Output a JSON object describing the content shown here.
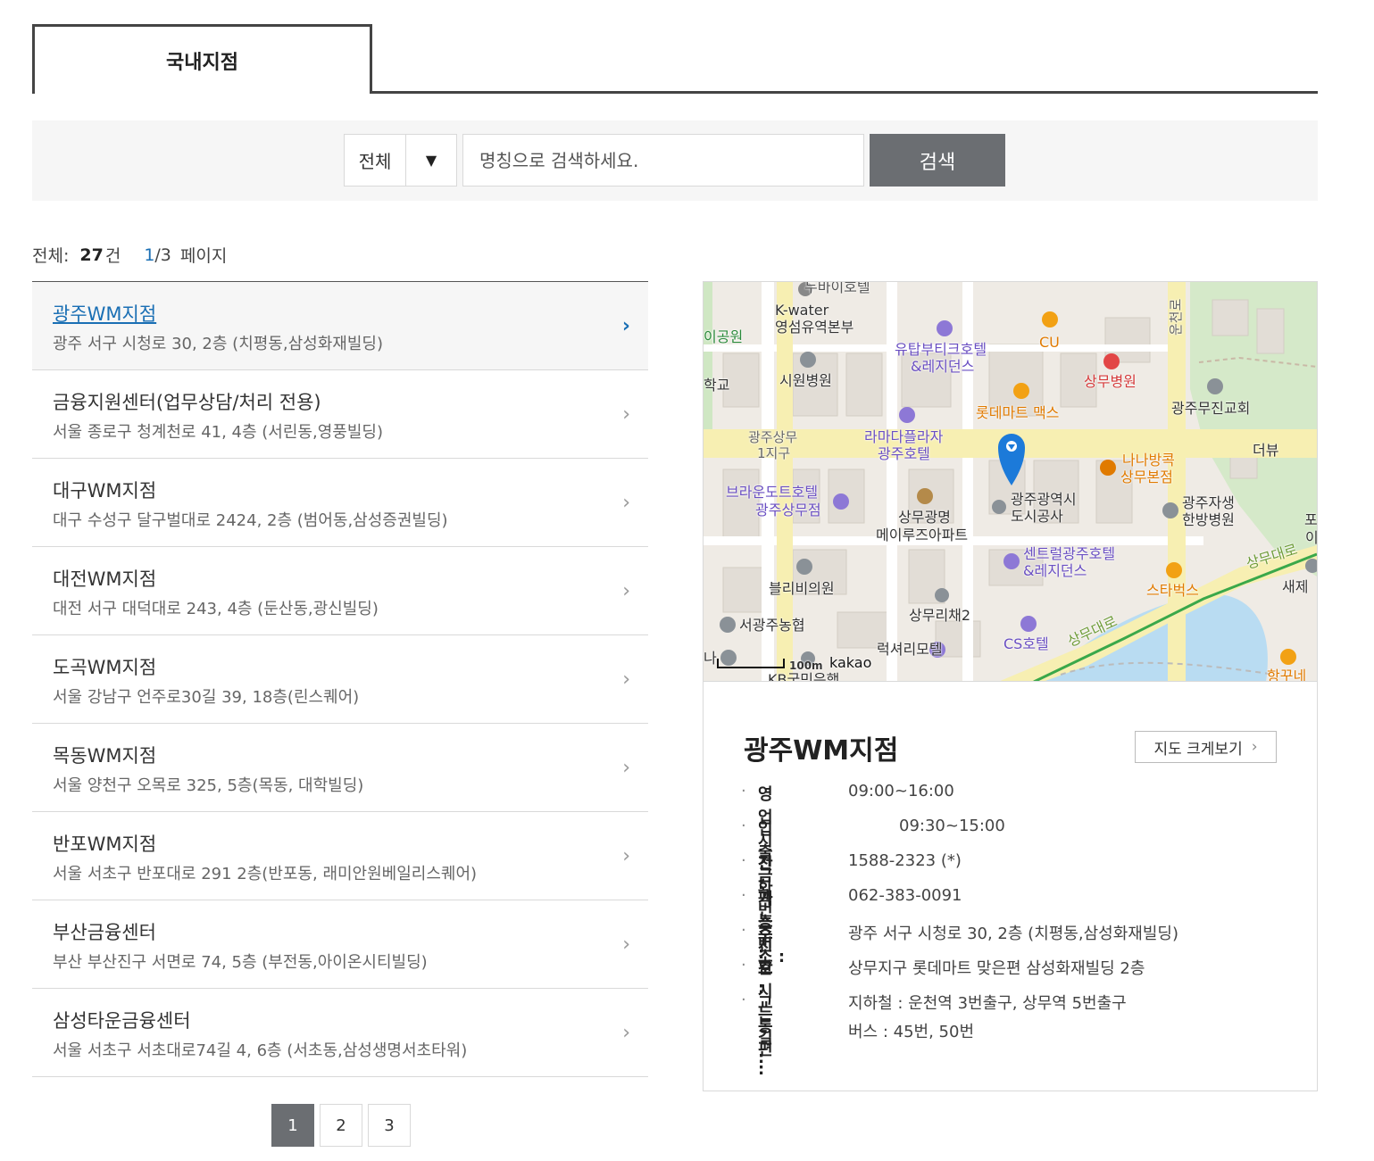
{
  "tabs": [
    {
      "label": "국내지점",
      "active": true
    }
  ],
  "search": {
    "category_selected": "전체",
    "placeholder": "명칭으로 검색하세요.",
    "button_label": "검색"
  },
  "summary": {
    "total_label": "전체:",
    "total_count": "27",
    "total_unit": "건",
    "current_page": "1",
    "total_pages": "/3",
    "page_label": "페이지"
  },
  "branches": [
    {
      "name": "광주WM지점",
      "address": "광주 서구 시청로 30, 2층 (치평동,삼성화재빌딩)",
      "active": true
    },
    {
      "name": "금융지원센터(업무상담/처리 전용)",
      "address": "서울 종로구 청계천로 41, 4층 (서린동,영풍빌딩)"
    },
    {
      "name": "대구WM지점",
      "address": "대구 수성구 달구벌대로 2424, 2층 (범어동,삼성증권빌딩)"
    },
    {
      "name": "대전WM지점",
      "address": "대전 서구 대덕대로 243, 4층 (둔산동,광신빌딩)"
    },
    {
      "name": "도곡WM지점",
      "address": "서울 강남구 언주로30길 39, 18층(린스퀘어)"
    },
    {
      "name": "목동WM지점",
      "address": "서울 양천구 오목로 325, 5층(목동, 대학빌딩)"
    },
    {
      "name": "반포WM지점",
      "address": "서울 서초구 반포대로 291 2층(반포동, 래미안원베일리스퀘어)"
    },
    {
      "name": "부산금융센터",
      "address": "부산 부산진구 서면로 74, 5층 (부전동,아이온시티빌딩)"
    },
    {
      "name": "삼성타운금융센터",
      "address": "서울 서초구 서초대로74길 4, 6층 (서초동,삼성생명서초타워)"
    }
  ],
  "chevron_glyph": "›",
  "pagination": {
    "pages": [
      "1",
      "2",
      "3"
    ],
    "current": "1"
  },
  "map": {
    "scale_label": "100m",
    "brand": "kakao",
    "labels": {
      "kwater_1": "K-water",
      "kwater_2": "영섬유역본부",
      "park": "이공원",
      "school": "학교",
      "utop_1": "유탑부티크호텔",
      "utop_2": "&레지던스",
      "cu": "CU",
      "siwon": "시원병원",
      "sangmu_hosp": "상무병원",
      "lotte": "롯데마트 맥스",
      "church": "광주무진교회",
      "theview": "더뷰",
      "ramada_1": "라마다플라자",
      "ramada_2": "광주호텔",
      "gwangju_sangmu_1": "광주상무",
      "gwangju_sangmu_2": "1지구",
      "nana_1": "나나방콕",
      "nana_2": "상무본점",
      "brown_1": "브라운도트호텔",
      "brown_2": "광주상무점",
      "metro_1": "광주광역시",
      "metro_2": "도시공사",
      "jasaeng_1": "광주자생",
      "jasaeng_2": "한방병원",
      "po": "포",
      "i": "이",
      "sangmu_gm_1": "상무광명",
      "sangmu_gm_2": "메이루즈아파트",
      "central_1": "센트럴광주호텔",
      "central_2": "&레지던스",
      "sangmudaero_1": "상무대로",
      "saejeil": "새제",
      "bullibi": "블리비의원",
      "starbucks": "스타벅스",
      "sangmu_richae": "상무리채2",
      "seo_nh": "서광주농협",
      "cs_hotel": "CS호텔",
      "sangmudaero_2": "상무대로",
      "luxury": "럭셔리모텔",
      "hanggum": "항꾸네",
      "unchun": "운천로",
      "na": "나",
      "kb": "KB국민은행",
      "top_hotel": "두바이호텔"
    }
  },
  "detail": {
    "title": "광주WM지점",
    "enlarge_label": "지도 크게보기",
    "bullet": "·",
    "info": [
      {
        "key": "영업시간 :",
        "value": "09:00~16:00"
      },
      {
        "key": "입출금가능시간 :",
        "value": "09:30~15:00"
      },
      {
        "key": "전화번호 :",
        "value": "1588-2323 (*)"
      },
      {
        "key": "팩스번호 :",
        "value": "062-383-0091"
      },
      {
        "key": "주　　소 :",
        "value": "광주 서구 시청로 30, 2층 (치평동,삼성화재빌딩)"
      },
      {
        "key": "오시는길 :",
        "value": "상무지구 롯데마트 맞은편 삼성화재빌딩 2층"
      },
      {
        "key": "교 통 편 :",
        "value": "지하철 : 운천역 3번출구, 상무역 5번출구",
        "value2": "버스 : 45번, 50번"
      }
    ]
  },
  "colors": {
    "accent": "#1a6fb4",
    "button": "#6b6e72",
    "road_main": "#f7efb2",
    "park": "#cfe7c3",
    "water": "#bde0f5"
  }
}
